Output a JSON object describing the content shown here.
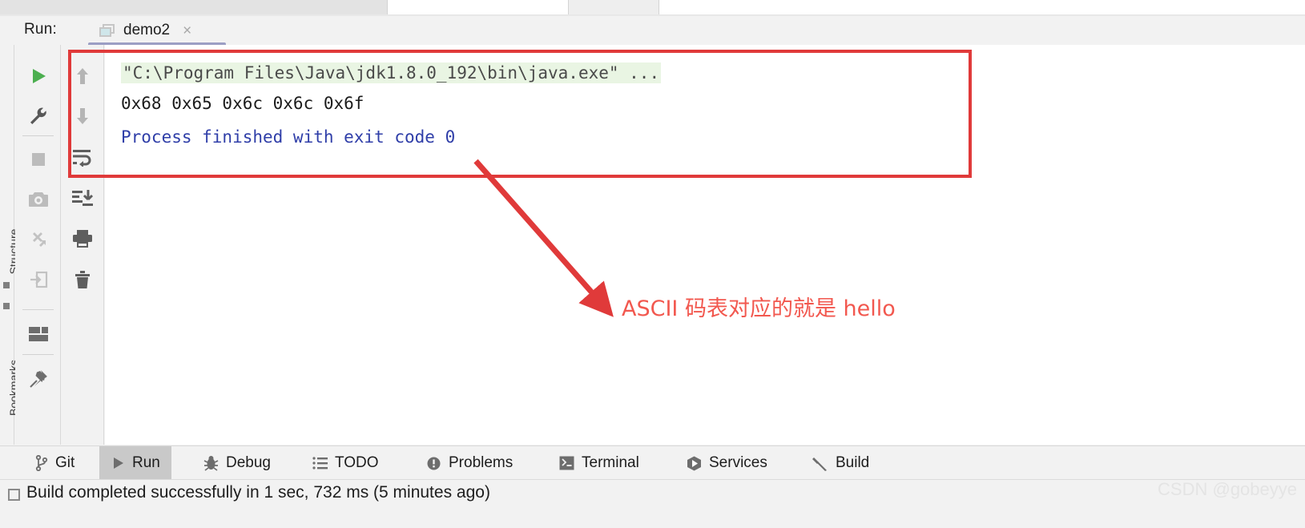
{
  "window": {
    "run_label": "Run:",
    "tab": {
      "title": "demo2",
      "close_label": "×",
      "icon": "run-configuration-icon"
    }
  },
  "side_stripe": {
    "labels": [
      "Structure",
      "Bookmarks"
    ]
  },
  "toolbar_primary": {
    "buttons": [
      {
        "name": "rerun-button",
        "icon": "play-icon",
        "tooltip": "Rerun"
      },
      {
        "name": "settings-button",
        "icon": "wrench-icon",
        "tooltip": "Modify Run Configuration"
      },
      {
        "name": "stop-button",
        "icon": "stop-square-icon",
        "tooltip": "Stop"
      },
      {
        "name": "screenshot-button",
        "icon": "camera-icon",
        "tooltip": "Screenshot"
      },
      {
        "name": "restore-layout-button",
        "icon": "bug-restore-icon",
        "tooltip": "Restore Layout"
      },
      {
        "name": "attach-button",
        "icon": "arrow-into-box-icon",
        "tooltip": "Attach"
      },
      {
        "name": "layout-button",
        "icon": "layout-icon",
        "tooltip": "Layout Settings"
      },
      {
        "name": "pin-button",
        "icon": "pin-icon",
        "tooltip": "Pin Tab"
      }
    ]
  },
  "toolbar_secondary": {
    "buttons": [
      {
        "name": "up-button",
        "icon": "arrow-up-icon",
        "tooltip": "Up the Stack Trace"
      },
      {
        "name": "down-button",
        "icon": "arrow-down-icon",
        "tooltip": "Down the Stack Trace"
      },
      {
        "name": "soft-wrap-button",
        "icon": "soft-wrap-icon",
        "tooltip": "Soft-Wrap"
      },
      {
        "name": "scroll-end-button",
        "icon": "scroll-to-end-icon",
        "tooltip": "Scroll to the End"
      },
      {
        "name": "print-button",
        "icon": "printer-icon",
        "tooltip": "Print"
      },
      {
        "name": "clear-button",
        "icon": "trash-icon",
        "tooltip": "Clear All"
      }
    ]
  },
  "console": {
    "lines": [
      {
        "text": "\"C:\\Program Files\\Java\\jdk1.8.0_192\\bin\\java.exe\" ...",
        "style": "command"
      },
      {
        "text": "0x68 0x65 0x6c 0x6c 0x6f",
        "style": "stdout"
      },
      {
        "text": "Process finished with exit code 0",
        "style": "system"
      }
    ]
  },
  "annotation": {
    "text": "ASCII 码表对应的就是 hello",
    "color": "#f2584f",
    "box_color": "#e03a3a"
  },
  "bottom_tabs": [
    {
      "label": "Git",
      "icon": "git-branch-icon",
      "active": false
    },
    {
      "label": "Run",
      "icon": "play-icon",
      "active": true
    },
    {
      "label": "Debug",
      "icon": "bug-icon",
      "active": false
    },
    {
      "label": "TODO",
      "icon": "list-icon",
      "active": false
    },
    {
      "label": "Problems",
      "icon": "warning-icon",
      "active": false
    },
    {
      "label": "Terminal",
      "icon": "terminal-icon",
      "active": false
    },
    {
      "label": "Services",
      "icon": "services-icon",
      "active": false
    },
    {
      "label": "Build",
      "icon": "hammer-icon",
      "active": false
    }
  ],
  "status_bar": {
    "message": "Build completed successfully in 1 sec, 732 ms (5 minutes ago)",
    "icon": "build-status-icon"
  },
  "watermark": {
    "text": "CSDN @gobeyye"
  }
}
